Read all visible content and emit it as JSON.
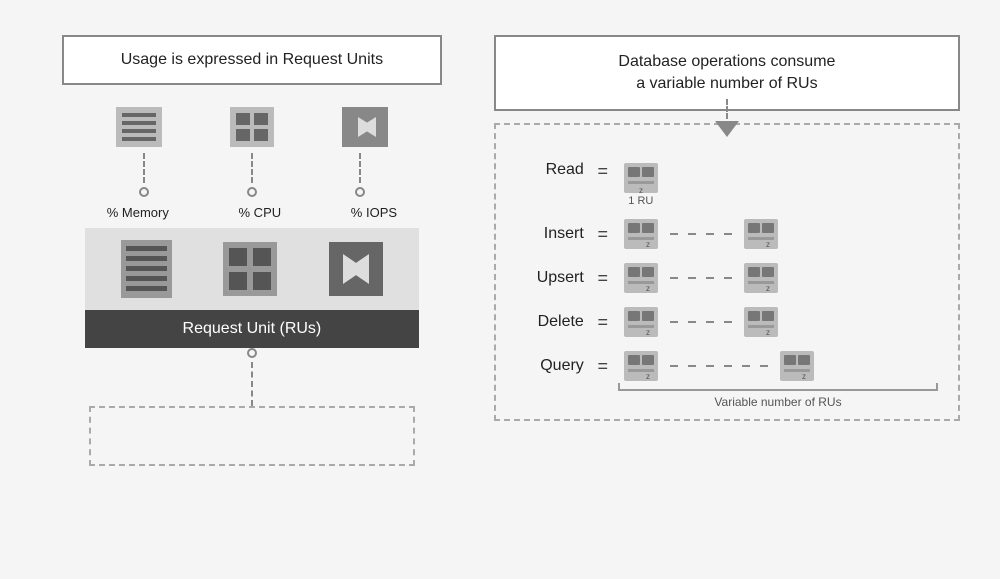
{
  "left": {
    "title": "Usage is expressed in Request Units",
    "resources": [
      {
        "label": "% Memory",
        "icon": "memory-icon"
      },
      {
        "label": "% CPU",
        "icon": "cpu-icon"
      },
      {
        "label": "% IOPS",
        "icon": "iops-icon"
      }
    ],
    "ru_label": "Request Unit (RUs)"
  },
  "right": {
    "title_line1": "Database operations consume",
    "title_line2": "a variable number of RUs",
    "operations": [
      {
        "name": "Read",
        "dots": 1
      },
      {
        "name": "Insert",
        "dots": 2
      },
      {
        "name": "Upsert",
        "dots": 2
      },
      {
        "name": "Delete",
        "dots": 2
      },
      {
        "name": "Query",
        "dots": 2
      }
    ],
    "variable_label": "Variable number of RUs",
    "one_ru": "1 RU"
  }
}
